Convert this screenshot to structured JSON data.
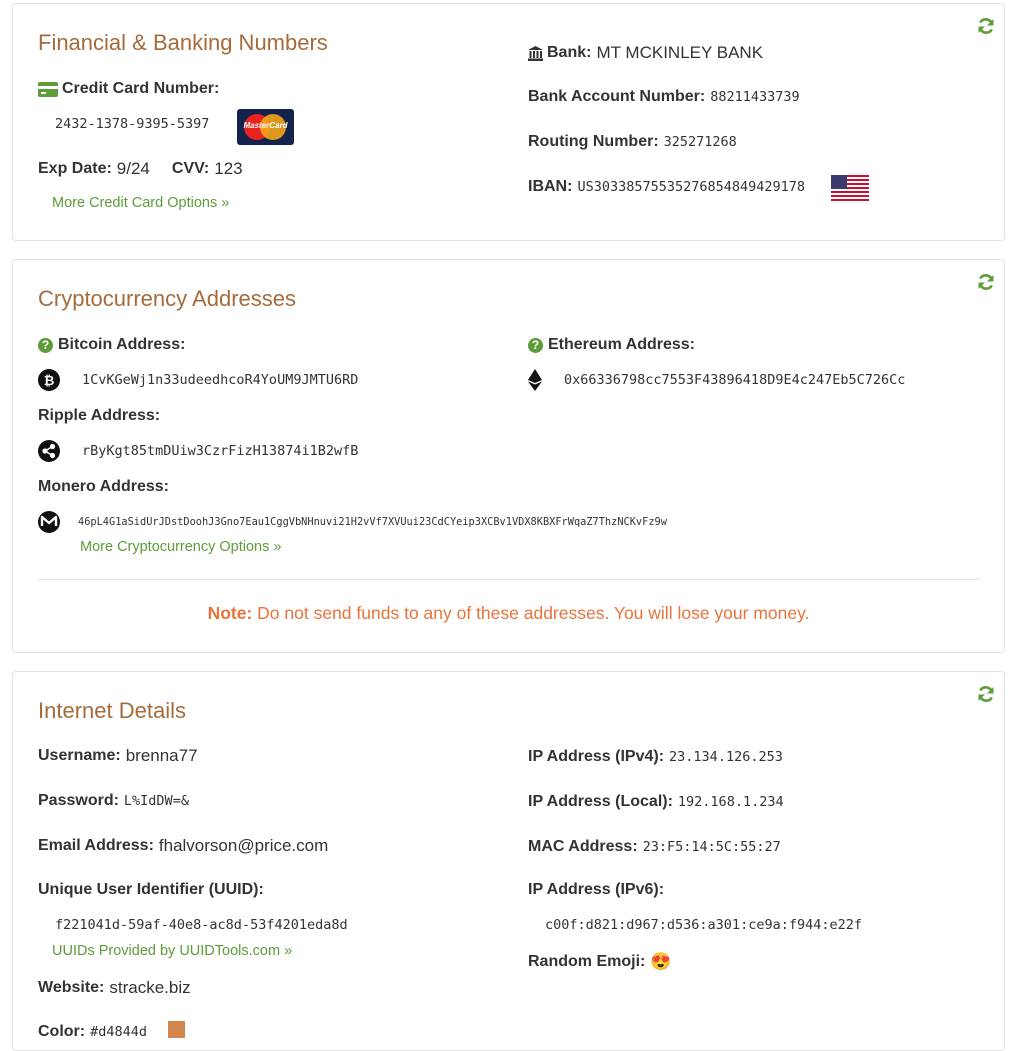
{
  "financial": {
    "title": "Financial & Banking Numbers",
    "cc_label": "Credit Card Number:",
    "cc_number": "2432-1378-9395-5397",
    "card_brand": "MasterCard",
    "exp_label": "Exp Date:",
    "exp_value": "9/24",
    "cvv_label": "CVV:",
    "cvv_value": "123",
    "more_link": "More Credit Card Options »",
    "bank_label": "Bank:",
    "bank_value": "MT MCKINLEY BANK",
    "account_label": "Bank Account Number:",
    "account_value": "88211433739",
    "routing_label": "Routing Number:",
    "routing_value": "325271268",
    "iban_label": "IBAN:",
    "iban_value": "US30338575535276854849429178"
  },
  "crypto": {
    "title": "Cryptocurrency Addresses",
    "bitcoin_label": "Bitcoin Address:",
    "bitcoin_value": "1CvKGeWj1n33udeedhcoR4YoUM9JMTU6RD",
    "ethereum_label": "Ethereum Address:",
    "ethereum_value": "0x66336798cc7553F43896418D9E4c247Eb5C726Cc",
    "ripple_label": "Ripple Address:",
    "ripple_value": "rByKgt85tmDUiw3CzrFizH13874i1B2wfB",
    "monero_label": "Monero Address:",
    "monero_value": "46pL4G1aSidUrJDstDoohJ3Gno7Eau1CggVbNHnuvi21H2vVf7XVUui23CdCYeip3XCBv1VDX8KBXFrWqaZ7ThzNCKvFz9w",
    "more_link": "More Cryptocurrency Options »",
    "note_label": "Note:",
    "note_text": "Do not send funds to any of these addresses. You will lose your money."
  },
  "internet": {
    "title": "Internet Details",
    "username_label": "Username:",
    "username_value": "brenna77",
    "password_label": "Password:",
    "password_value": "L%IdDW=&",
    "email_label": "Email Address:",
    "email_value": "fhalvorson@price.com",
    "uuid_label": "Unique User Identifier (UUID):",
    "uuid_value": "f221041d-59af-40e8-ac8d-53f4201eda8d",
    "uuid_link": "UUIDs Provided by UUIDTools.com »",
    "website_label": "Website:",
    "website_value": "stracke.biz",
    "color_label": "Color:",
    "color_value": "#d4844d",
    "ipv4_label": "IP Address (IPv4):",
    "ipv4_value": "23.134.126.253",
    "local_label": "IP Address (Local):",
    "local_value": "192.168.1.234",
    "mac_label": "MAC Address:",
    "mac_value": "23:F5:14:5C:55:27",
    "ipv6_label": "IP Address (IPv6):",
    "ipv6_value": "c00f:d821:d967:d536:a301:ce9a:f944:e22f",
    "emoji_label": "Random Emoji:",
    "emoji_value": "😍"
  },
  "colors": {
    "accent": "#5e9c3a",
    "heading": "#a66b3a",
    "note": "#e8743b",
    "swatch": "#d4844d"
  }
}
